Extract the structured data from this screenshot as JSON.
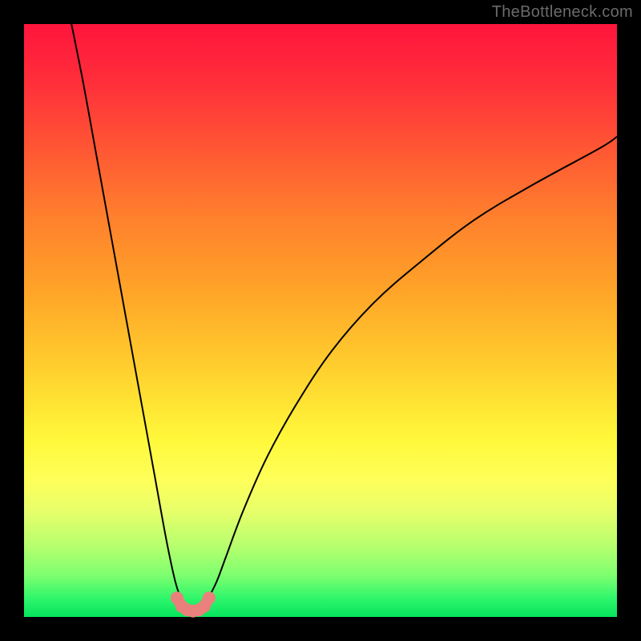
{
  "watermark": "TheBottleneck.com",
  "chart_data": {
    "type": "line",
    "title": "",
    "xlabel": "",
    "ylabel": "",
    "xlim": [
      0,
      100
    ],
    "ylim": [
      0,
      100
    ],
    "grid": false,
    "legend": false,
    "series": [
      {
        "name": "left-branch",
        "color": "#000000",
        "x": [
          8,
          10,
          12,
          14,
          16,
          18,
          20,
          22,
          24,
          25.5,
          26.5
        ],
        "y": [
          100,
          90,
          79,
          68,
          57,
          46,
          35,
          24,
          13,
          6,
          3
        ]
      },
      {
        "name": "right-branch",
        "color": "#000000",
        "x": [
          31,
          32.5,
          34,
          37,
          41,
          46,
          52,
          59,
          67,
          76,
          86,
          97,
          100
        ],
        "y": [
          3,
          6,
          10,
          18,
          27,
          36,
          45,
          53,
          60,
          67,
          73,
          79,
          81
        ]
      },
      {
        "name": "valley-marker",
        "color": "#e9807b",
        "x": [
          25.8,
          26.6,
          27.5,
          28.5,
          29.5,
          30.4,
          31.2
        ],
        "y": [
          3.2,
          1.8,
          1.2,
          1.0,
          1.2,
          1.8,
          3.2
        ]
      }
    ],
    "annotations": []
  }
}
